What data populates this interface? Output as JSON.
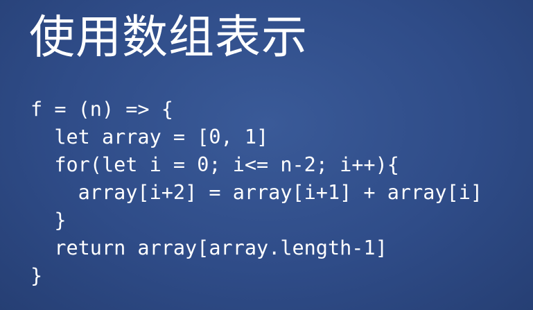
{
  "slide": {
    "title": "使用数组表示",
    "code_lines": [
      "f = (n) => {",
      "  let array = [0, 1]",
      "  for(let i = 0; i<= n-2; i++){",
      "    array[i+2] = array[i+1] + array[i]",
      "  }",
      "  return array[array.length-1]",
      "}"
    ]
  },
  "colors": {
    "background": "#2f4c88",
    "text": "#ffffff"
  }
}
